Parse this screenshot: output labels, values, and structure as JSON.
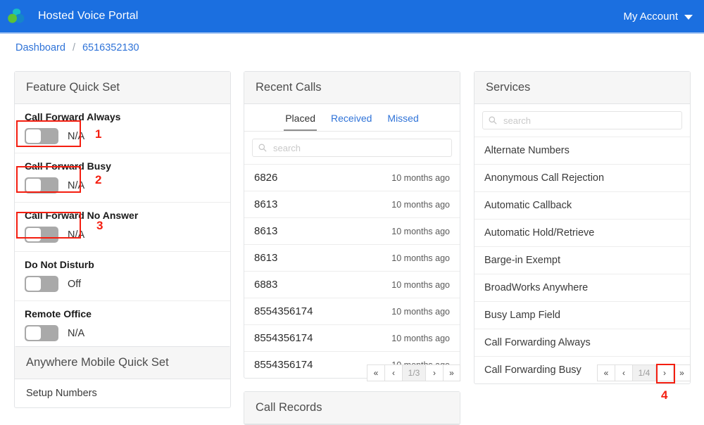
{
  "header": {
    "app_title": "Hosted Voice Portal",
    "account_label": "My Account",
    "brand_blue": "#1b6fe0",
    "logo_colors": [
      "#5bc236",
      "#18bfc4",
      "#1585c9"
    ]
  },
  "breadcrumb": {
    "items": [
      {
        "label": "Dashboard"
      },
      {
        "label": "6516352130"
      }
    ],
    "separator": "/"
  },
  "feature_quick_set": {
    "title": "Feature Quick Set",
    "rows": [
      {
        "label": "Call Forward Always",
        "state": "N/A",
        "toggle": "off"
      },
      {
        "label": "Call Forward Busy",
        "state": "N/A",
        "toggle": "off"
      },
      {
        "label": "Call Forward No Answer",
        "state": "N/A",
        "toggle": "off"
      },
      {
        "label": "Do Not Disturb",
        "state": "Off",
        "toggle": "off"
      },
      {
        "label": "Remote Office",
        "state": "N/A",
        "toggle": "off"
      }
    ]
  },
  "anywhere_mobile_quick_set": {
    "title": "Anywhere Mobile Quick Set",
    "rows": [
      {
        "label": "Setup Numbers"
      }
    ]
  },
  "recent_calls": {
    "title": "Recent Calls",
    "tabs": [
      {
        "label": "Placed",
        "active": true
      },
      {
        "label": "Received",
        "active": false
      },
      {
        "label": "Missed",
        "active": false
      }
    ],
    "search": {
      "placeholder": "search",
      "value": "",
      "icon": "search-icon"
    },
    "rows": [
      {
        "number": "6826",
        "time": "10 months ago"
      },
      {
        "number": "8613",
        "time": "10 months ago"
      },
      {
        "number": "8613",
        "time": "10 months ago"
      },
      {
        "number": "8613",
        "time": "10 months ago"
      },
      {
        "number": "6883",
        "time": "10 months ago"
      },
      {
        "number": "8554356174",
        "time": "10 months ago"
      },
      {
        "number": "8554356174",
        "time": "10 months ago"
      },
      {
        "number": "8554356174",
        "time": "10 months ago"
      }
    ],
    "pagination": {
      "first": "«",
      "prev": "‹",
      "page_label": "1/3",
      "next": "›",
      "last": "»"
    }
  },
  "call_records": {
    "title": "Call Records"
  },
  "services": {
    "title": "Services",
    "search": {
      "placeholder": "search",
      "value": "",
      "icon": "search-icon"
    },
    "rows": [
      {
        "label": "Alternate Numbers"
      },
      {
        "label": "Anonymous Call Rejection"
      },
      {
        "label": "Automatic Callback"
      },
      {
        "label": "Automatic Hold/Retrieve"
      },
      {
        "label": "Barge-in Exempt"
      },
      {
        "label": "BroadWorks Anywhere"
      },
      {
        "label": "Busy Lamp Field"
      },
      {
        "label": "Call Forwarding Always"
      },
      {
        "label": "Call Forwarding Busy"
      }
    ],
    "pagination": {
      "first": "«",
      "prev": "‹",
      "page_label": "1/4",
      "next": "›",
      "last": "»"
    }
  },
  "annotations": {
    "color": "#f41e10",
    "markers": [
      {
        "number": "1"
      },
      {
        "number": "2"
      },
      {
        "number": "3"
      },
      {
        "number": "4"
      }
    ]
  }
}
